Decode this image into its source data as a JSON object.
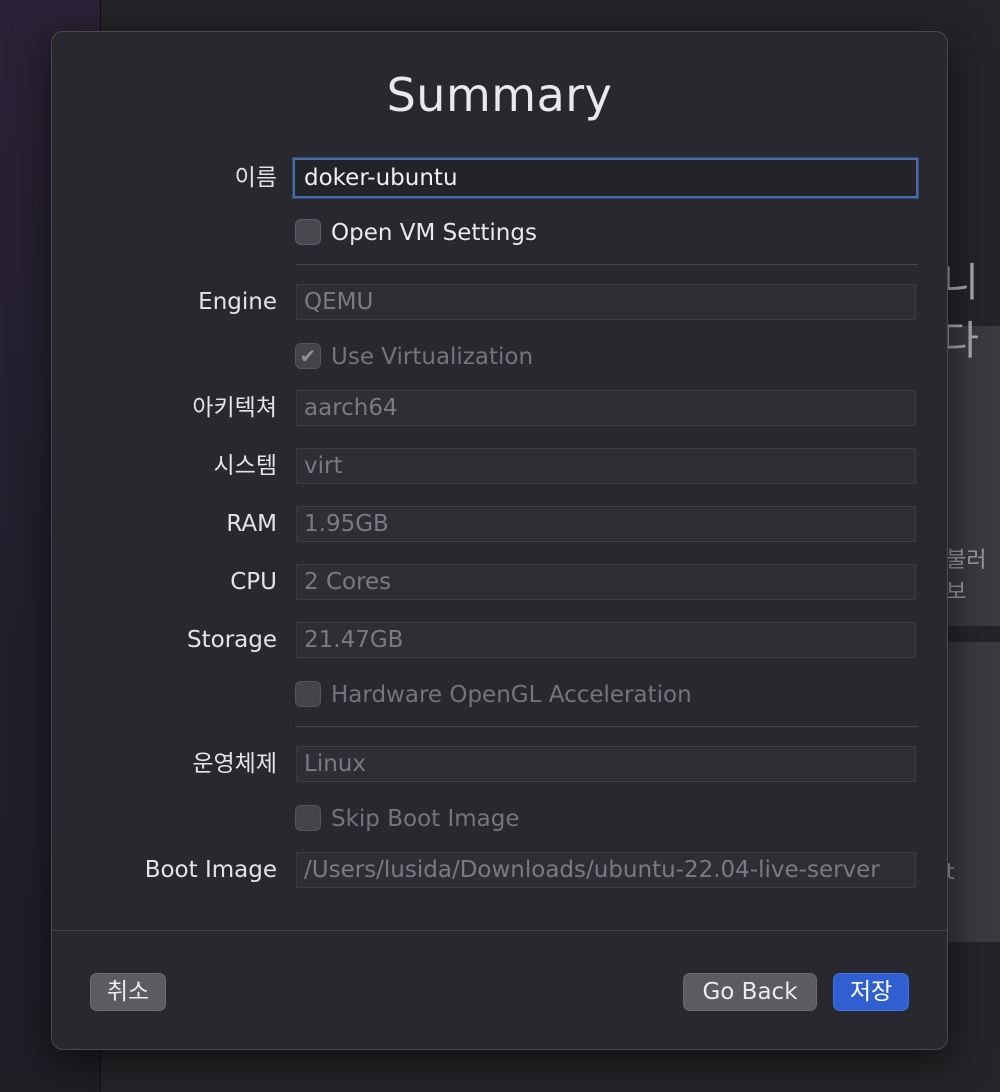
{
  "background": {
    "ghost_text_1": "니다",
    "ghost_text_2": "불러보",
    "ghost_text_3": "t"
  },
  "dialog": {
    "title": "Summary",
    "name": {
      "label": "이름",
      "value": "doker-ubuntu"
    },
    "open_vm_settings": {
      "label": "Open VM Settings",
      "checked": false
    },
    "engine": {
      "label": "Engine",
      "value": "QEMU"
    },
    "use_virtualization": {
      "label": "Use Virtualization",
      "checked": true
    },
    "architecture": {
      "label": "아키텍쳐",
      "value": "aarch64"
    },
    "system": {
      "label": "시스템",
      "value": "virt"
    },
    "ram": {
      "label": "RAM",
      "value": "1.95GB"
    },
    "cpu": {
      "label": "CPU",
      "value": "2 Cores"
    },
    "storage": {
      "label": "Storage",
      "value": "21.47GB"
    },
    "hardware_opengl": {
      "label": "Hardware OpenGL Acceleration",
      "checked": false
    },
    "os": {
      "label": "운영체제",
      "value": "Linux"
    },
    "skip_boot_image": {
      "label": "Skip Boot Image",
      "checked": false
    },
    "boot_image": {
      "label": "Boot Image",
      "value": "/Users/lusida/Downloads/ubuntu-22.04-live-server"
    },
    "buttons": {
      "cancel": "취소",
      "go_back": "Go Back",
      "save": "저장"
    }
  },
  "colors": {
    "accent": "#2f5fd0",
    "focus_ring": "#4a6ea3",
    "dialog_bg": "#29282f"
  },
  "icons": {
    "checkmark": "checkmark-icon"
  }
}
